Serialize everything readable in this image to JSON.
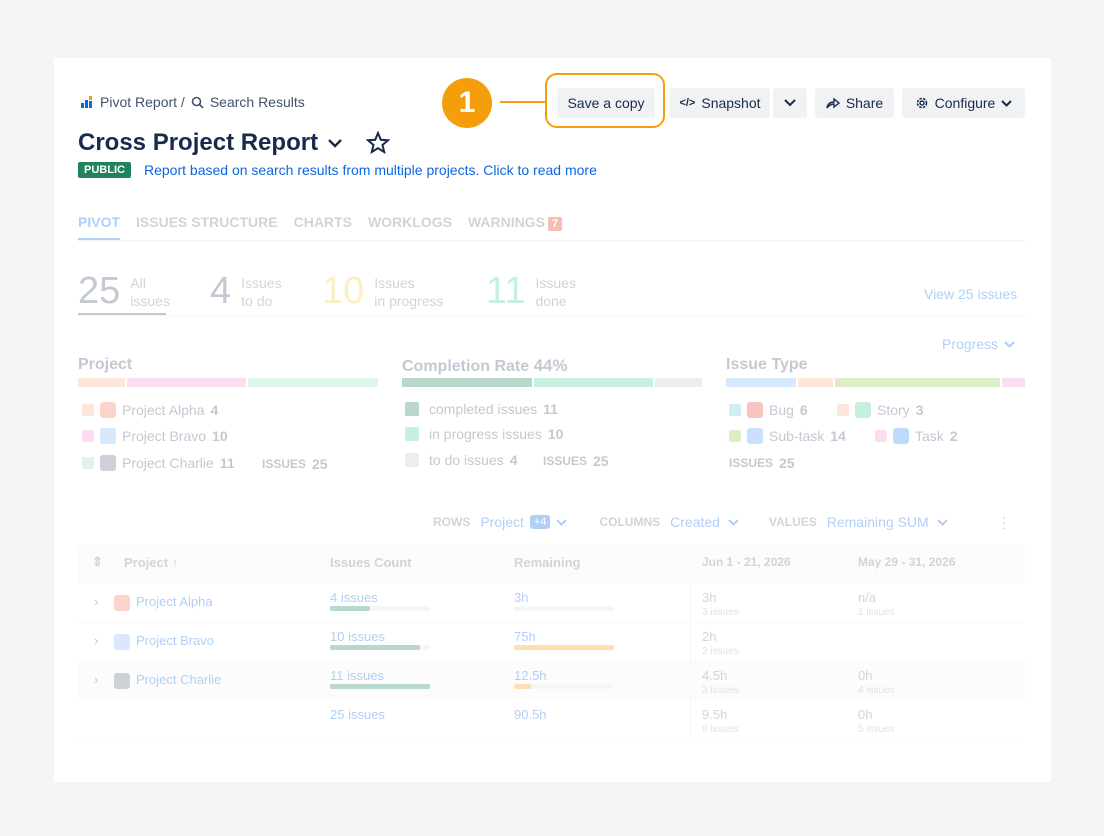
{
  "breadcrumb": {
    "root": "Pivot Report /",
    "current": "Search Results"
  },
  "toolbar": {
    "save": "Save a copy",
    "snapshot": "Snapshot",
    "share": "Share",
    "configure": "Configure"
  },
  "callout": {
    "number": "1",
    "color": "#f59e0b"
  },
  "report": {
    "title": "Cross Project Report",
    "badge": "PUBLIC",
    "description": "Report based on search results from multiple projects. Click to read more"
  },
  "tabs": [
    {
      "label": "PIVOT"
    },
    {
      "label": "ISSUES STRUCTURE"
    },
    {
      "label": "CHARTS"
    },
    {
      "label": "WORKLOGS"
    },
    {
      "label": "WARNINGS",
      "count": "7"
    }
  ],
  "stats": [
    {
      "num": "25",
      "l1": "All",
      "l2": "issues",
      "color": "#42526e"
    },
    {
      "num": "4",
      "l1": "Issues",
      "l2": "to do",
      "color": "#42526e"
    },
    {
      "num": "10",
      "l1": "Issues",
      "l2": "in progress",
      "color": "#f5cd47"
    },
    {
      "num": "11",
      "l1": "Issues",
      "l2": "done",
      "color": "#4bce97"
    }
  ],
  "view_all": "View 25 issues",
  "progress_label": "Progress",
  "project_panel": {
    "title": "Project",
    "items": [
      {
        "label": "Project Alpha",
        "count": "4"
      },
      {
        "label": "Project Bravo",
        "count": "10"
      },
      {
        "label": "Project Charlie",
        "count": "11"
      }
    ],
    "issues_label": "ISSUES",
    "issues_total": "25"
  },
  "completion_panel": {
    "title": "Completion Rate",
    "rate": "44%",
    "items": [
      {
        "label": "completed issues",
        "count": "11"
      },
      {
        "label": "in progress issues",
        "count": "10"
      },
      {
        "label": "to do issues",
        "count": "4"
      }
    ],
    "issues_label": "ISSUES",
    "issues_total": "25"
  },
  "type_panel": {
    "title": "Issue Type",
    "items": [
      {
        "label": "Bug",
        "count": "6"
      },
      {
        "label": "Story",
        "count": "3"
      },
      {
        "label": "Sub-task",
        "count": "14"
      },
      {
        "label": "Task",
        "count": "2"
      }
    ],
    "issues_label": "ISSUES",
    "issues_total": "25"
  },
  "controls": {
    "rows_label": "ROWS",
    "rows_value": "Project",
    "rows_extra": "+4",
    "columns_label": "COLUMNS",
    "columns_value": "Created",
    "values_label": "VALUES",
    "values_value": "Remaining SUM"
  },
  "table": {
    "headers": [
      "Project",
      "Issues Count",
      "Remaining",
      "Jun 1 - 21, 2026",
      "May 29 - 31, 2026"
    ],
    "rows": [
      {
        "name": "Project Alpha",
        "count": "4 issues",
        "count_fill": 0.4,
        "remaining": "3h",
        "rem_fill": 0,
        "c1": "3h",
        "c1s": "3 issues",
        "c2": "n/a",
        "c2s": "1 issues"
      },
      {
        "name": "Project Bravo",
        "count": "10 issues",
        "count_fill": 0.9,
        "remaining": "75h",
        "rem_fill": 1,
        "c1": "2h",
        "c1s": "2 issues",
        "c2": "",
        "c2s": ""
      },
      {
        "name": "Project Charlie",
        "count": "11 issues",
        "count_fill": 1,
        "remaining": "12.5h",
        "rem_fill": 0.17,
        "c1": "4.5h",
        "c1s": "3 issues",
        "c2": "0h",
        "c2s": "4 issues"
      }
    ],
    "total": {
      "count": "25 issues",
      "remaining": "90.5h",
      "c1": "9.5h",
      "c1s": "8 issues",
      "c2": "0h",
      "c2s": "5 issues"
    }
  }
}
